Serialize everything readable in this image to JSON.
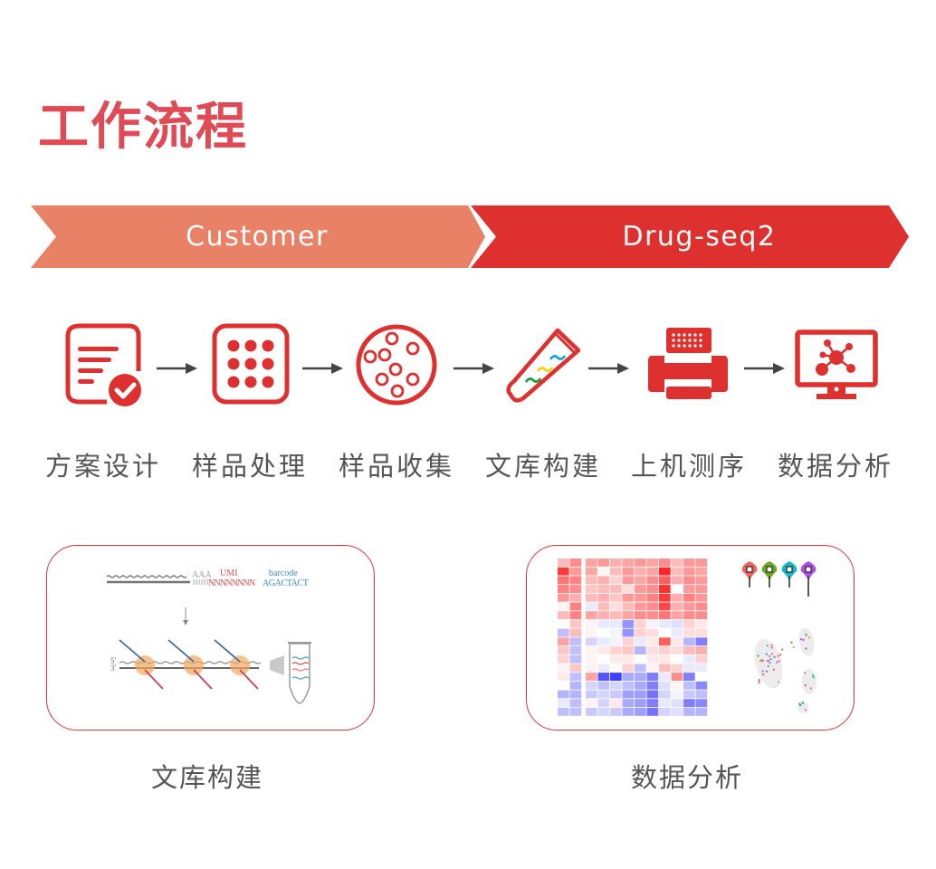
{
  "page": {
    "title": "工作流程",
    "accent_color": "#e04a55"
  },
  "phases": [
    {
      "label": "Customer",
      "color": "#e88166"
    },
    {
      "label": "Drug-seq2",
      "color": "#dd302f"
    }
  ],
  "steps": [
    {
      "label": "方案设计",
      "icon": "document-check-icon"
    },
    {
      "label": "样品处理",
      "icon": "well-plate-icon"
    },
    {
      "label": "样品收集",
      "icon": "petri-dish-icon"
    },
    {
      "label": "文库构建",
      "icon": "test-tube-icon"
    },
    {
      "label": "上机测序",
      "icon": "sequencer-icon"
    },
    {
      "label": "数据分析",
      "icon": "monitor-network-icon"
    }
  ],
  "step_arrow_icon": "right-arrow-icon",
  "cards": [
    {
      "caption": "文库构建",
      "figure": {
        "umi_label": "UMI",
        "umi_seq": "NNNNNNNN",
        "barcode_label": "barcode",
        "barcode_seq": "AGACTACT",
        "polya": "AAA",
        "polyt": "TTTTTT",
        "five_prime": "5'",
        "three_prime": "3'"
      }
    },
    {
      "caption": "数据分析",
      "figure": {
        "heatmap_rows": [
          [
            0.3,
            0.5,
            0.4,
            0.45,
            0.35,
            0.4,
            0.45,
            0.4,
            0.5,
            0.3,
            0.45,
            0.45
          ],
          [
            0.85,
            0.45,
            0.4,
            0.05,
            0.3,
            0.45,
            0.35,
            0.4,
            0.95,
            0.3,
            0.45,
            0.4
          ],
          [
            0.6,
            0.55,
            0.3,
            0.35,
            0.2,
            0.45,
            0.4,
            0.5,
            0.7,
            0.35,
            0.5,
            0.45
          ],
          [
            0.55,
            0.5,
            0.25,
            0.3,
            0.3,
            0.15,
            0.45,
            0.5,
            0.9,
            0.0,
            0.45,
            0.45
          ],
          [
            0.45,
            0.35,
            0.3,
            0.35,
            0.25,
            0.45,
            0.45,
            0.55,
            0.85,
            0.35,
            0.55,
            0.45
          ],
          [
            0.05,
            0.55,
            -0.1,
            0.3,
            0.15,
            0.3,
            0.45,
            0.5,
            0.8,
            0.35,
            0.45,
            0.5
          ],
          [
            0.3,
            0.55,
            0.4,
            0.35,
            0.3,
            0.4,
            0.5,
            0.5,
            0.6,
            0.4,
            0.5,
            0.5
          ],
          [
            0.0,
            0.25,
            0.05,
            -0.1,
            -0.1,
            -0.5,
            0.2,
            -0.05,
            -0.1,
            -0.15,
            0.2,
            0.1
          ],
          [
            -0.3,
            0.3,
            0.05,
            0.0,
            -0.05,
            -0.5,
            0.2,
            0.15,
            0.0,
            -0.1,
            0.15,
            0.15
          ],
          [
            0.4,
            -0.3,
            -0.2,
            -0.1,
            -0.05,
            0.2,
            -0.1,
            0.1,
            0.7,
            0.1,
            -0.35,
            -0.6
          ],
          [
            0.25,
            -0.3,
            0.05,
            0.1,
            0.2,
            0.25,
            -0.35,
            0.15,
            0.2,
            0.15,
            0.3,
            0.35
          ],
          [
            0.2,
            -0.3,
            0.05,
            0.0,
            0.1,
            0.1,
            0.0,
            0.1,
            0.1,
            0.0,
            -0.1,
            0.2
          ],
          [
            0.05,
            0.25,
            0.05,
            -0.1,
            0.0,
            0.2,
            -0.3,
            0.05,
            0.3,
            0.2,
            -0.1,
            -0.1
          ],
          [
            0.1,
            -0.3,
            0.4,
            -0.8,
            -0.9,
            -0.4,
            -0.4,
            -0.6,
            -0.1,
            0.5,
            -0.6,
            0.0
          ],
          [
            0.0,
            -0.35,
            -0.2,
            -0.3,
            -0.2,
            -0.3,
            -0.4,
            -0.6,
            -0.15,
            0.05,
            -0.3,
            -0.55
          ],
          [
            -0.35,
            -0.35,
            -0.25,
            -0.2,
            -0.25,
            -0.45,
            -0.45,
            -0.65,
            -0.2,
            -0.05,
            -0.25,
            -0.3
          ],
          [
            -0.1,
            -0.3,
            0.05,
            -0.2,
            0.1,
            -0.4,
            -0.45,
            -0.6,
            -0.1,
            -0.15,
            -0.6,
            -0.55
          ],
          [
            -0.3,
            -0.3,
            -0.25,
            -0.2,
            -0.25,
            -0.4,
            -0.45,
            -0.65,
            -0.2,
            -0.15,
            -0.35,
            -0.35
          ]
        ],
        "violin_colors": [
          "#f0625c",
          "#6aa81f",
          "#17b8c0",
          "#b04ce0"
        ]
      }
    }
  ]
}
